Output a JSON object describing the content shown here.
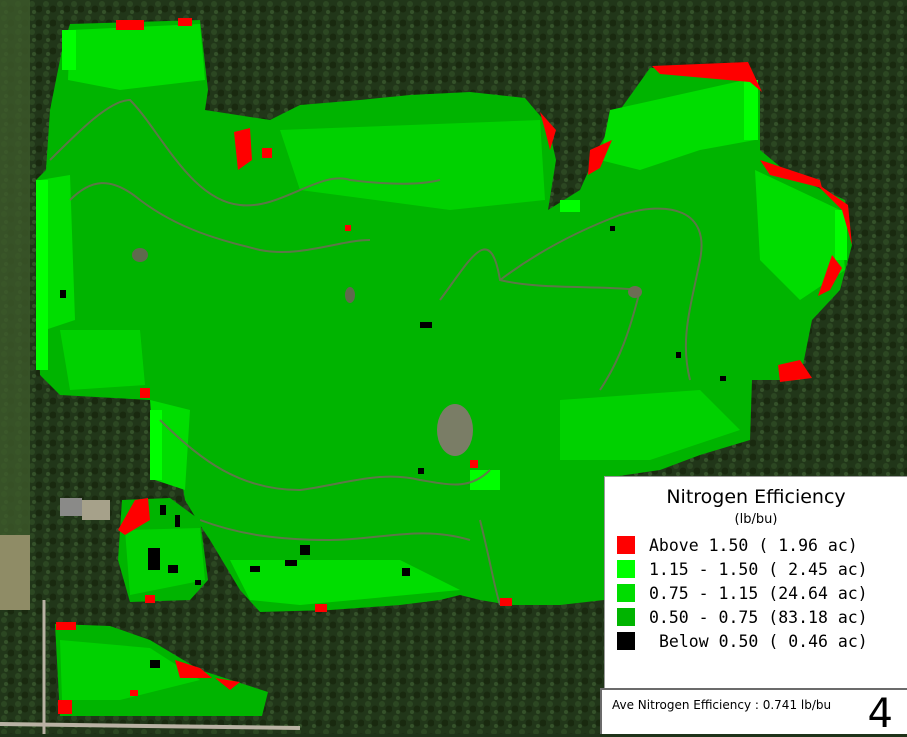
{
  "map": {
    "colors": {
      "background_forest": "#1f3319",
      "forest_patch": "#2b4423",
      "crop_field_outside": "#6f8a4a",
      "road": "#b9b2a4",
      "above_150": "#ff0000",
      "range_115_150": "#00ff00",
      "range_075_115": "#00dd00",
      "range_050_075": "#00b400",
      "below_050": "#000000",
      "tracks": "#6d6d55"
    }
  },
  "legend": {
    "title": "Nitrogen Efficiency",
    "unit": "(lb/bu)",
    "items": [
      {
        "label": "Above 1.50",
        "area": "( 1.96 ac)",
        "color": "#ff0000"
      },
      {
        "label": "1.15 - 1.50",
        "area": "( 2.45 ac)",
        "color": "#00ff00"
      },
      {
        "label": "0.75 - 1.15",
        "area": "(24.64 ac)",
        "color": "#00dd00"
      },
      {
        "label": "0.50 - 0.75",
        "area": "(83.18 ac)",
        "color": "#00b400"
      },
      {
        "label": "Below 0.50",
        "area": "( 0.46 ac)",
        "color": "#000000"
      }
    ]
  },
  "footer": {
    "average_text": "Ave Nitrogen Efficiency : 0.741 lb/bu",
    "page_number": "4"
  }
}
